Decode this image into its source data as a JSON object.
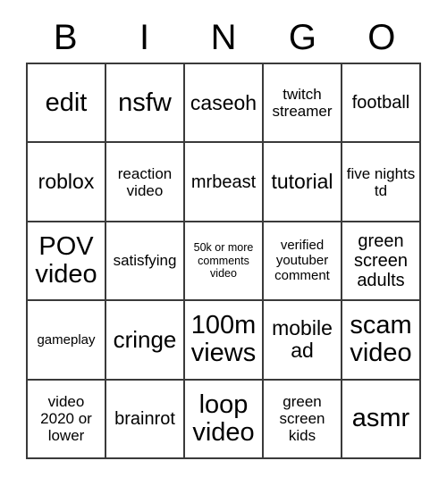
{
  "card": {
    "header_letters": [
      "B",
      "I",
      "N",
      "G",
      "O"
    ],
    "columns": 5,
    "rows": 5,
    "colors": {
      "background": "#ffffff",
      "text": "#000000",
      "grid_line": "#3a3a3a"
    },
    "cells": [
      {
        "text": "edit",
        "size": "fs-xl"
      },
      {
        "text": "nsfw",
        "size": "fs-xl"
      },
      {
        "text": "caseoh",
        "size": "fs-ml"
      },
      {
        "text": "twitch streamer",
        "size": "fs-sm"
      },
      {
        "text": "football",
        "size": "fs-md"
      },
      {
        "text": "roblox",
        "size": "fs-ml"
      },
      {
        "text": "reaction video",
        "size": "fs-sm"
      },
      {
        "text": "mrbeast",
        "size": "fs-md"
      },
      {
        "text": "tutorial",
        "size": "fs-ml"
      },
      {
        "text": "five nights td",
        "size": "fs-sm"
      },
      {
        "text": "POV video",
        "size": "fs-xl"
      },
      {
        "text": "satisfying",
        "size": "fs-sm"
      },
      {
        "text": "50k or more comments video",
        "size": "fs-xxs"
      },
      {
        "text": "verified youtuber comment",
        "size": "fs-xs"
      },
      {
        "text": "green screen adults",
        "size": "fs-md"
      },
      {
        "text": "gameplay",
        "size": "fs-xs"
      },
      {
        "text": "cringe",
        "size": "fs-lg"
      },
      {
        "text": "100m views",
        "size": "fs-xl"
      },
      {
        "text": "mobile ad",
        "size": "fs-ml"
      },
      {
        "text": "scam video",
        "size": "fs-xl"
      },
      {
        "text": "video 2020 or lower",
        "size": "fs-sm"
      },
      {
        "text": "brainrot",
        "size": "fs-md"
      },
      {
        "text": "loop video",
        "size": "fs-xl"
      },
      {
        "text": "green screen kids",
        "size": "fs-sm"
      },
      {
        "text": "asmr",
        "size": "fs-xl"
      }
    ]
  }
}
